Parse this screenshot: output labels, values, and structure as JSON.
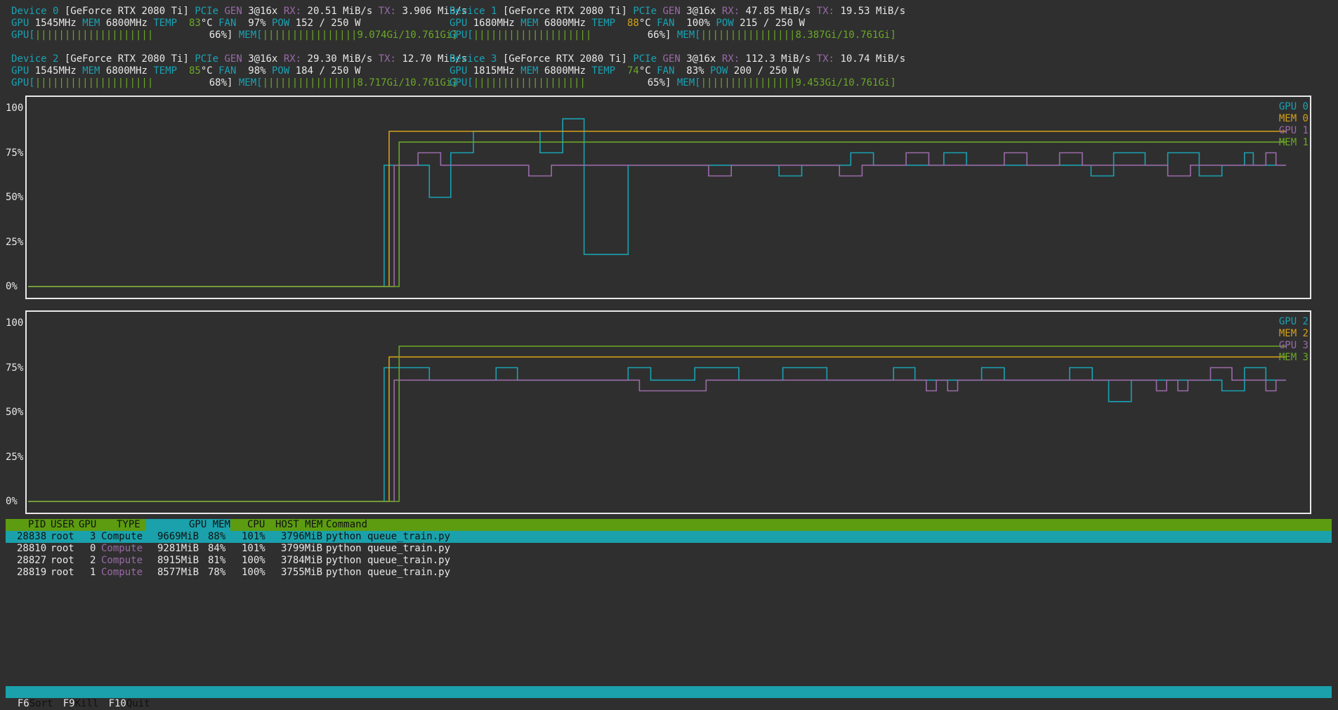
{
  "devices": [
    {
      "label": "Device 0",
      "model": "[GeForce RTX 2080 Ti]",
      "pcie": "3@16x",
      "rx": "20.51 MiB/s",
      "tx": "3.906 MiB/s",
      "gpu_clk": "1545MHz",
      "mem_clk": "6800MHz",
      "temp": "83",
      "fan": "97%",
      "pow": "152 / 250 W",
      "gpu_bar": "||||||||||||||||||||",
      "gpu_pct": "66%]",
      "mem_bar": "||||||||||||||||",
      "mem_use": "9.074Gi/10.761Gi]"
    },
    {
      "label": "Device 1",
      "model": "[GeForce RTX 2080 Ti]",
      "pcie": "3@16x",
      "rx": "47.85 MiB/s",
      "tx": "19.53 MiB/s",
      "gpu_clk": "1680MHz",
      "mem_clk": "6800MHz",
      "temp": "88",
      "fan": "100%",
      "pow": "215 / 250 W",
      "gpu_bar": "||||||||||||||||||||",
      "gpu_pct": "66%]",
      "mem_bar": "||||||||||||||||",
      "mem_use": "8.387Gi/10.761Gi]"
    },
    {
      "label": "Device 2",
      "model": "[GeForce RTX 2080 Ti]",
      "pcie": "3@16x",
      "rx": "29.30 MiB/s",
      "tx": "12.70 MiB/s",
      "gpu_clk": "1545MHz",
      "mem_clk": "6800MHz",
      "temp": "85",
      "fan": "98%",
      "pow": "184 / 250 W",
      "gpu_bar": "||||||||||||||||||||",
      "gpu_pct": "68%]",
      "mem_bar": "||||||||||||||||",
      "mem_use": "8.717Gi/10.761Gi]"
    },
    {
      "label": "Device 3",
      "model": "[GeForce RTX 2080 Ti]",
      "pcie": "3@16x",
      "rx": "112.3 MiB/s",
      "tx": "10.74 MiB/s",
      "gpu_clk": "1815MHz",
      "mem_clk": "6800MHz",
      "temp": "74",
      "fan": "83%",
      "pow": "200 / 250 W",
      "gpu_bar": "|||||||||||||||||||",
      "gpu_pct": "65%]",
      "mem_bar": "||||||||||||||||",
      "mem_use": "9.453Gi/10.761Gi]"
    }
  ],
  "labels": {
    "pcie": "PCIe",
    "gen": "GEN",
    "rx": "RX:",
    "tx": "TX:",
    "gpu": "GPU",
    "mem": "MEM",
    "temp": "TEMP",
    "fan": "FAN",
    "pow": "POW",
    "degc": "°C",
    "gpu_open": "GPU[",
    "mem_open": "MEM["
  },
  "colors": {
    "bg": "#2f2f2f",
    "cyan": "#19a2b3",
    "magenta": "#9a6aa8",
    "yellow": "#d4a017",
    "green": "#6ba826"
  },
  "chart_data": [
    {
      "type": "line",
      "title": "",
      "yticks": [
        "100",
        "75%",
        "50%",
        "25%",
        "0%"
      ],
      "ylim": [
        0,
        100
      ],
      "xlim": [
        0,
        100
      ],
      "legend": [
        "GPU 0",
        "MEM 0",
        "GPU 1",
        "MEM 1"
      ],
      "legend_placement": "top-right",
      "series": [
        {
          "name": "GPU 0",
          "color": "#19a2b3",
          "points": [
            [
              0,
              0
            ],
            [
              28.3,
              0
            ],
            [
              28.3,
              68
            ],
            [
              31.9,
              68
            ],
            [
              31.9,
              50
            ],
            [
              33.6,
              50
            ],
            [
              33.6,
              75
            ],
            [
              35.4,
              75
            ],
            [
              35.4,
              87
            ],
            [
              40.7,
              87
            ],
            [
              40.7,
              75
            ],
            [
              42.5,
              75
            ],
            [
              42.5,
              94
            ],
            [
              44.2,
              94
            ],
            [
              44.2,
              18
            ],
            [
              47.7,
              18
            ],
            [
              47.7,
              68
            ],
            [
              59.7,
              68
            ],
            [
              59.7,
              62
            ],
            [
              61.5,
              62
            ],
            [
              61.5,
              68
            ],
            [
              65.4,
              68
            ],
            [
              65.4,
              75
            ],
            [
              67.2,
              75
            ],
            [
              67.2,
              68
            ],
            [
              72.8,
              68
            ],
            [
              72.8,
              75
            ],
            [
              74.6,
              75
            ],
            [
              74.6,
              68
            ],
            [
              84.5,
              68
            ],
            [
              84.5,
              62
            ],
            [
              86.3,
              62
            ],
            [
              86.3,
              75
            ],
            [
              88.8,
              75
            ],
            [
              88.8,
              68
            ],
            [
              90.6,
              68
            ],
            [
              90.6,
              75
            ],
            [
              93.1,
              75
            ],
            [
              93.1,
              62
            ],
            [
              94.9,
              62
            ],
            [
              94.9,
              68
            ],
            [
              96.7,
              68
            ],
            [
              96.7,
              75
            ],
            [
              97.4,
              75
            ],
            [
              97.4,
              68
            ],
            [
              100,
              68
            ]
          ]
        },
        {
          "name": "MEM 0",
          "color": "#d4a017",
          "points": [
            [
              0,
              0
            ],
            [
              28.7,
              0
            ],
            [
              28.7,
              87
            ],
            [
              100,
              87
            ]
          ]
        },
        {
          "name": "GPU 1",
          "color": "#9a6aa8",
          "points": [
            [
              0,
              0
            ],
            [
              29.1,
              0
            ],
            [
              29.1,
              68
            ],
            [
              31.0,
              68
            ],
            [
              31.0,
              75
            ],
            [
              32.8,
              75
            ],
            [
              32.8,
              68
            ],
            [
              39.8,
              68
            ],
            [
              39.8,
              62
            ],
            [
              41.6,
              62
            ],
            [
              41.6,
              68
            ],
            [
              54.1,
              68
            ],
            [
              54.1,
              62
            ],
            [
              55.9,
              62
            ],
            [
              55.9,
              68
            ],
            [
              64.5,
              68
            ],
            [
              64.5,
              62
            ],
            [
              66.3,
              62
            ],
            [
              66.3,
              68
            ],
            [
              69.8,
              68
            ],
            [
              69.8,
              75
            ],
            [
              71.6,
              75
            ],
            [
              71.6,
              68
            ],
            [
              77.6,
              68
            ],
            [
              77.6,
              75
            ],
            [
              79.4,
              75
            ],
            [
              79.4,
              68
            ],
            [
              82.0,
              68
            ],
            [
              82.0,
              75
            ],
            [
              83.8,
              75
            ],
            [
              83.8,
              68
            ],
            [
              90.6,
              68
            ],
            [
              90.6,
              62
            ],
            [
              92.4,
              62
            ],
            [
              92.4,
              68
            ],
            [
              98.4,
              68
            ],
            [
              98.4,
              75
            ],
            [
              99.2,
              75
            ],
            [
              99.2,
              68
            ],
            [
              100,
              68
            ]
          ]
        },
        {
          "name": "MEM 1",
          "color": "#6ba826",
          "points": [
            [
              0,
              0
            ],
            [
              29.5,
              0
            ],
            [
              29.5,
              81
            ],
            [
              100,
              81
            ]
          ]
        }
      ]
    },
    {
      "type": "line",
      "title": "",
      "yticks": [
        "100",
        "75%",
        "50%",
        "25%",
        "0%"
      ],
      "ylim": [
        0,
        100
      ],
      "xlim": [
        0,
        100
      ],
      "legend": [
        "GPU 2",
        "MEM 2",
        "GPU 3",
        "MEM 3"
      ],
      "legend_placement": "top-right",
      "series": [
        {
          "name": "GPU 2",
          "color": "#19a2b3",
          "points": [
            [
              0,
              0
            ],
            [
              28.3,
              0
            ],
            [
              28.3,
              75
            ],
            [
              31.9,
              75
            ],
            [
              31.9,
              68
            ],
            [
              37.2,
              68
            ],
            [
              37.2,
              75
            ],
            [
              38.9,
              75
            ],
            [
              38.9,
              68
            ],
            [
              47.7,
              68
            ],
            [
              47.7,
              75
            ],
            [
              49.5,
              75
            ],
            [
              49.5,
              68
            ],
            [
              53.0,
              68
            ],
            [
              53.0,
              75
            ],
            [
              56.5,
              75
            ],
            [
              56.5,
              68
            ],
            [
              60.0,
              68
            ],
            [
              60.0,
              75
            ],
            [
              63.5,
              75
            ],
            [
              63.5,
              68
            ],
            [
              68.8,
              68
            ],
            [
              68.8,
              75
            ],
            [
              70.5,
              75
            ],
            [
              70.5,
              68
            ],
            [
              75.8,
              68
            ],
            [
              75.8,
              75
            ],
            [
              77.6,
              75
            ],
            [
              77.6,
              68
            ],
            [
              82.8,
              68
            ],
            [
              82.8,
              75
            ],
            [
              84.6,
              75
            ],
            [
              84.6,
              68
            ],
            [
              85.9,
              68
            ],
            [
              85.9,
              56
            ],
            [
              87.7,
              56
            ],
            [
              87.7,
              68
            ],
            [
              94.9,
              68
            ],
            [
              94.9,
              62
            ],
            [
              96.7,
              62
            ],
            [
              96.7,
              75
            ],
            [
              98.4,
              75
            ],
            [
              98.4,
              68
            ],
            [
              100,
              68
            ]
          ]
        },
        {
          "name": "MEM 2",
          "color": "#d4a017",
          "points": [
            [
              0,
              0
            ],
            [
              28.7,
              0
            ],
            [
              28.7,
              81
            ],
            [
              100,
              81
            ]
          ]
        },
        {
          "name": "GPU 3",
          "color": "#9a6aa8",
          "points": [
            [
              0,
              0
            ],
            [
              29.1,
              0
            ],
            [
              29.1,
              68
            ],
            [
              48.6,
              68
            ],
            [
              48.6,
              62
            ],
            [
              53.9,
              62
            ],
            [
              53.9,
              68
            ],
            [
              71.4,
              68
            ],
            [
              71.4,
              62
            ],
            [
              72.2,
              62
            ],
            [
              72.2,
              68
            ],
            [
              73.1,
              68
            ],
            [
              73.1,
              62
            ],
            [
              73.9,
              62
            ],
            [
              73.9,
              68
            ],
            [
              89.7,
              68
            ],
            [
              89.7,
              62
            ],
            [
              90.5,
              62
            ],
            [
              90.5,
              68
            ],
            [
              91.4,
              68
            ],
            [
              91.4,
              62
            ],
            [
              92.2,
              62
            ],
            [
              92.2,
              68
            ],
            [
              94.0,
              68
            ],
            [
              94.0,
              75
            ],
            [
              95.7,
              75
            ],
            [
              95.7,
              68
            ],
            [
              98.4,
              68
            ],
            [
              98.4,
              62
            ],
            [
              99.2,
              62
            ],
            [
              99.2,
              68
            ],
            [
              100,
              68
            ]
          ]
        },
        {
          "name": "MEM 3",
          "color": "#6ba826",
          "points": [
            [
              0,
              0
            ],
            [
              29.5,
              0
            ],
            [
              29.5,
              87
            ],
            [
              100,
              87
            ]
          ]
        }
      ]
    }
  ],
  "process_table": {
    "header": {
      "pid": "PID",
      "user": "USER",
      "gpu": "GPU",
      "type": "TYPE",
      "gpu_mem": "GPU MEM",
      "cpu": "CPU",
      "host_mem": "HOST MEM",
      "command": "Command"
    },
    "rows": [
      {
        "pid": "28838",
        "user": "root",
        "gpu": "3",
        "type": "Compute",
        "gpu_mem": "9669MiB",
        "gpu_mem_pct": "88%",
        "cpu": "101%",
        "host_mem": "3796MiB",
        "command": "python queue_train.py",
        "selected": true
      },
      {
        "pid": "28810",
        "user": "root",
        "gpu": "0",
        "type": "Compute",
        "gpu_mem": "9281MiB",
        "gpu_mem_pct": "84%",
        "cpu": "101%",
        "host_mem": "3799MiB",
        "command": "python queue_train.py",
        "selected": false
      },
      {
        "pid": "28827",
        "user": "root",
        "gpu": "2",
        "type": "Compute",
        "gpu_mem": "8915MiB",
        "gpu_mem_pct": "81%",
        "cpu": "100%",
        "host_mem": "3784MiB",
        "command": "python queue_train.py",
        "selected": false
      },
      {
        "pid": "28819",
        "user": "root",
        "gpu": "1",
        "type": "Compute",
        "gpu_mem": "8577MiB",
        "gpu_mem_pct": "78%",
        "cpu": "100%",
        "host_mem": "3755MiB",
        "command": "python queue_train.py",
        "selected": false
      }
    ]
  },
  "footer": [
    {
      "key": "F6",
      "label": "Sort"
    },
    {
      "key": "F9",
      "label": "Kill"
    },
    {
      "key": "F10",
      "label": "Quit"
    }
  ]
}
